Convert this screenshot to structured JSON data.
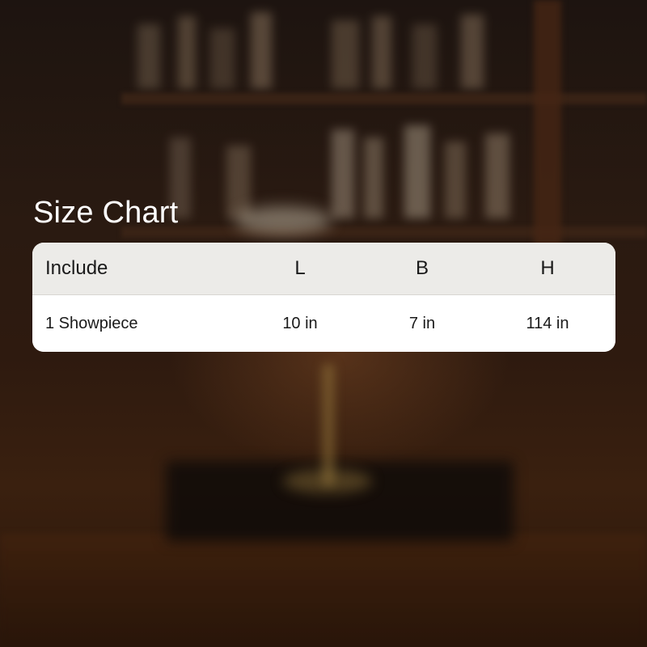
{
  "size_chart": {
    "title": "Size Chart",
    "columns": [
      "Include",
      "L",
      "B",
      "H"
    ],
    "rows": [
      [
        "1 Showpiece",
        "10 in",
        "7 in",
        "114 in"
      ]
    ]
  }
}
